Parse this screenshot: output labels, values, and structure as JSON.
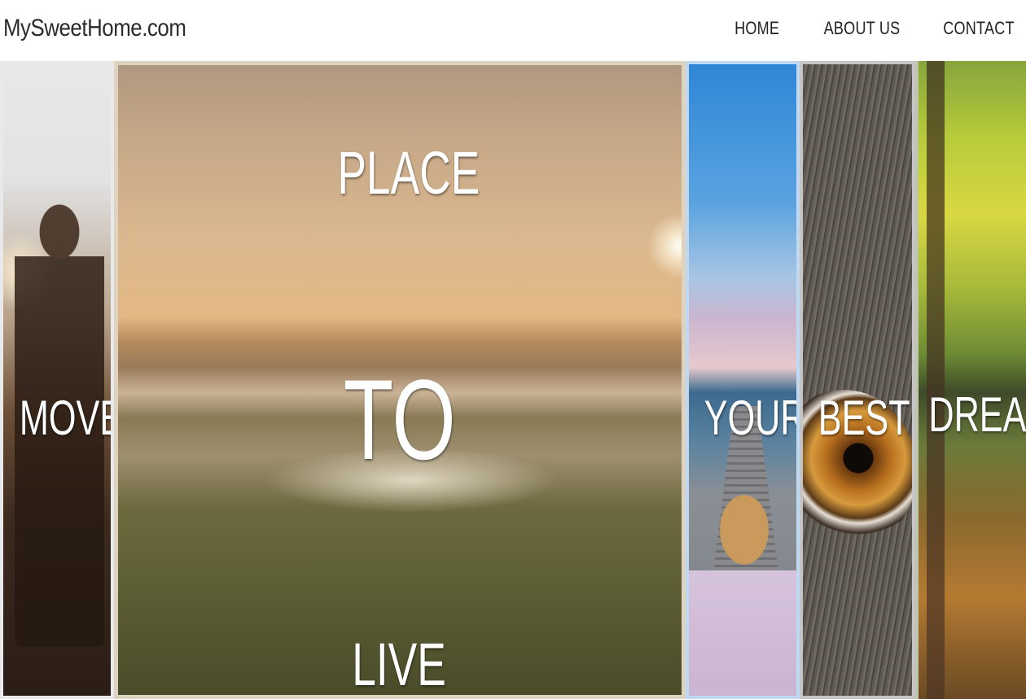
{
  "brand": {
    "name": "MySweetHome.com"
  },
  "nav": {
    "links": [
      "HOME",
      "ABOUT US",
      "CONTACT"
    ]
  },
  "hero": {
    "strips": [
      {
        "id": "move",
        "words": [
          "MOVE"
        ]
      },
      {
        "id": "place",
        "words": [
          "PLACE",
          "TO",
          "LIVE"
        ]
      },
      {
        "id": "your",
        "words": [
          "YOUR"
        ]
      },
      {
        "id": "best",
        "words": [
          "BEST"
        ]
      },
      {
        "id": "dream",
        "words": [
          "DREAM"
        ]
      }
    ]
  }
}
